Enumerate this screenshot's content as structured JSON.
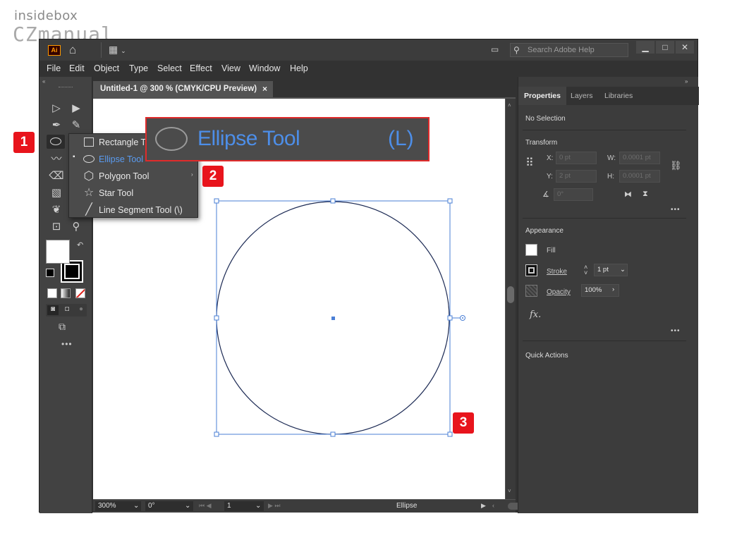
{
  "watermark": {
    "line1": "insidebox",
    "line2": "CZmanual"
  },
  "titlebar": {
    "app_logo": "Ai",
    "search_placeholder": "Search Adobe Help",
    "minimize": "▁",
    "maximize": "□",
    "close": "✕"
  },
  "menu": [
    "File",
    "Edit",
    "Object",
    "Type",
    "Select",
    "Effect",
    "View",
    "Window",
    "Help"
  ],
  "document": {
    "tab_title": "Untitled-1 @ 300 % (CMYK/CPU Preview)",
    "tab_close": "×"
  },
  "flyout": {
    "items": [
      {
        "label": "Rectangle Tool",
        "shortcut": "",
        "icon": "rectangle-icon",
        "active": false
      },
      {
        "label": "Ellipse Tool",
        "shortcut": "",
        "icon": "ellipse-icon",
        "active": true
      },
      {
        "label": "Polygon Tool",
        "shortcut": "",
        "icon": "polygon-icon",
        "active": false
      },
      {
        "label": "Star Tool",
        "shortcut": "",
        "icon": "star-icon",
        "active": false
      },
      {
        "label": "Line Segment Tool",
        "shortcut": "(\\)",
        "icon": "line-icon",
        "active": false
      }
    ]
  },
  "callout": {
    "tool_name": "Ellipse Tool",
    "shortcut": "(L)"
  },
  "badges": [
    "1",
    "2",
    "3"
  ],
  "statusbar": {
    "zoom": "300%",
    "rotation": "0°",
    "artboard": "1",
    "tool": "Ellipse"
  },
  "panel": {
    "tabs": [
      "Properties",
      "Layers",
      "Libraries"
    ],
    "selection": "No Selection",
    "transform": {
      "title": "Transform",
      "x_label": "X:",
      "x": "0 pt",
      "y_label": "Y:",
      "y": "2 pt",
      "w_label": "W:",
      "w": "0.0001 pt",
      "h_label": "H:",
      "h": "0.0001 pt",
      "angle": "0°"
    },
    "appearance": {
      "title": "Appearance",
      "fill": "Fill",
      "stroke": "Stroke",
      "stroke_weight": "1 pt",
      "opacity_label": "Opacity",
      "opacity": "100%",
      "fx": "fx."
    },
    "quick_actions": "Quick Actions",
    "more": "•••"
  },
  "colors": {
    "accent": "#4d8ee8",
    "badge": "#e8141c",
    "selection": "#4a7fd6",
    "ellipse_stroke": "#1d2b55"
  }
}
